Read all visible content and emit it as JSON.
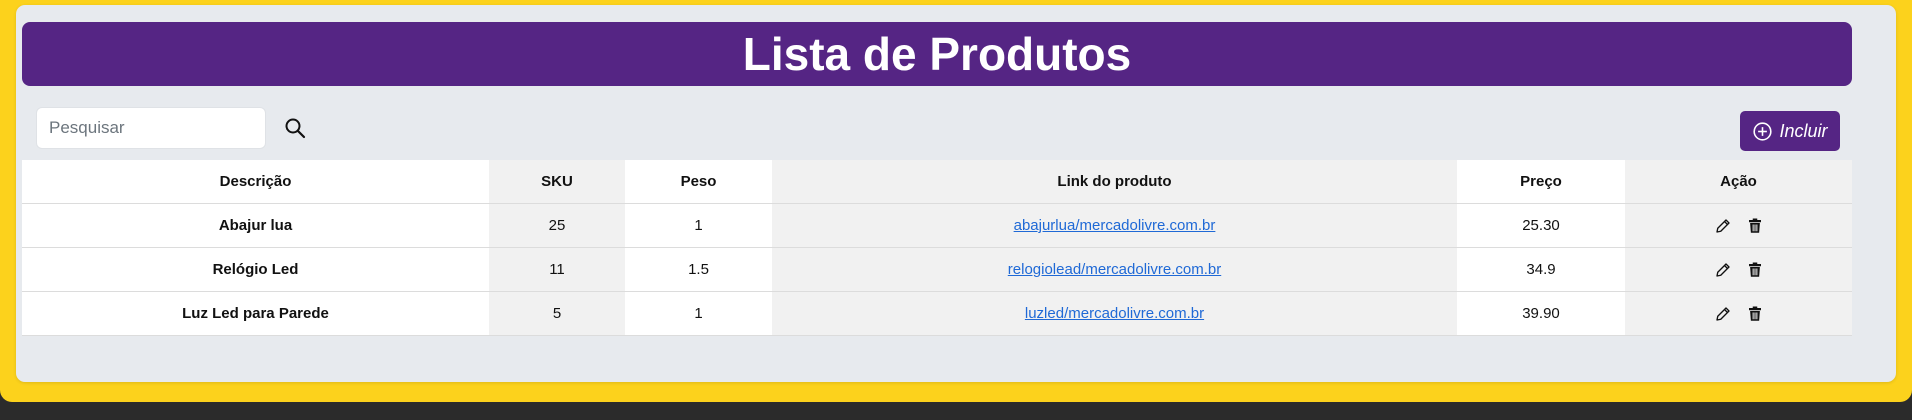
{
  "header": {
    "title": "Lista de Produtos"
  },
  "search": {
    "placeholder": "Pesquisar",
    "value": ""
  },
  "toolbar": {
    "add_label": "Incluir"
  },
  "table": {
    "columns": [
      "Descrição",
      "SKU",
      "Peso",
      "Link do produto",
      "Preço",
      "Ação"
    ],
    "rows": [
      {
        "descricao": "Abajur lua",
        "sku": "25",
        "peso": "1",
        "link": "abajurlua/mercadolivre.com.br",
        "preco": "25.30"
      },
      {
        "descricao": "Relógio Led",
        "sku": "11",
        "peso": "1.5",
        "link": "relogiolead/mercadolivre.com.br",
        "preco": "34.9"
      },
      {
        "descricao": "Luz Led para Parede",
        "sku": "5",
        "peso": "1",
        "link": "luzled/mercadolivre.com.br",
        "preco": "39.90"
      }
    ]
  },
  "icons": {
    "search": "search-icon",
    "add": "plus-circle-icon",
    "edit": "pencil-icon",
    "delete": "trash-icon"
  },
  "colors": {
    "frame": "#fcd21c",
    "brand": "#552584",
    "link": "#1f69d6"
  }
}
